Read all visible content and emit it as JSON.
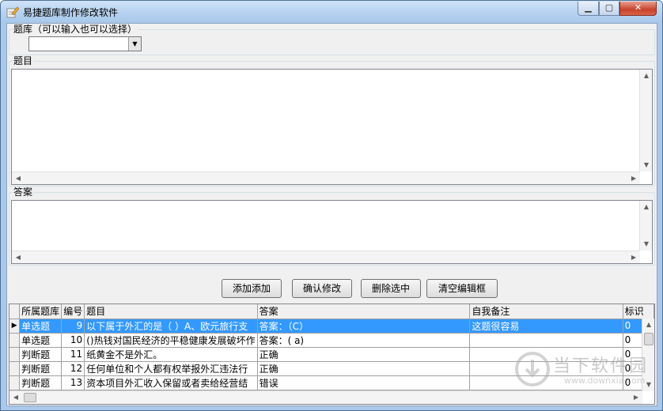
{
  "window": {
    "title": "易捷题库制作修改软件"
  },
  "titlebar": {
    "min_label": "▁",
    "max_label": "▢",
    "close_label": "✕"
  },
  "bank_group": {
    "label": "题库（可以输入也可以选择）",
    "combo_value": ""
  },
  "question_group": {
    "label": "题目",
    "text": ""
  },
  "answer_group": {
    "label": "答案",
    "text": ""
  },
  "buttons": {
    "add": "添加添加",
    "confirm": "确认修改",
    "delete": "删除选中",
    "clear": "清空编辑框"
  },
  "grid": {
    "columns": [
      "所属题库",
      "编号",
      "题目",
      "答案",
      "自我备注",
      "标识"
    ],
    "rows": [
      {
        "bank": "单选题",
        "id": "9",
        "question": "以下属于外汇的是（ ）A、欧元旅行支",
        "answer": "答案：（C）",
        "note": "这题很容易",
        "flag": "0",
        "selected": true
      },
      {
        "bank": "单选题",
        "id": "10",
        "question": "()热钱对国民经济的平稳健康发展破坏作",
        "answer": "答案：( a)",
        "note": "",
        "flag": "0",
        "selected": false
      },
      {
        "bank": "判断题",
        "id": "11",
        "question": "纸黄金不是外汇。",
        "answer": "正确",
        "note": "",
        "flag": "0",
        "selected": false
      },
      {
        "bank": "判断题",
        "id": "12",
        "question": "任何单位和个人都有权举报外汇违法行",
        "answer": "正确",
        "note": "",
        "flag": "0",
        "selected": false
      },
      {
        "bank": "判断题",
        "id": "13",
        "question": "资本项目外汇收入保留或者卖给经营结",
        "answer": "错误",
        "note": "",
        "flag": "0",
        "selected": false
      }
    ]
  },
  "watermark": {
    "brand": "当下软件园",
    "url": "www.downxia.com"
  }
}
